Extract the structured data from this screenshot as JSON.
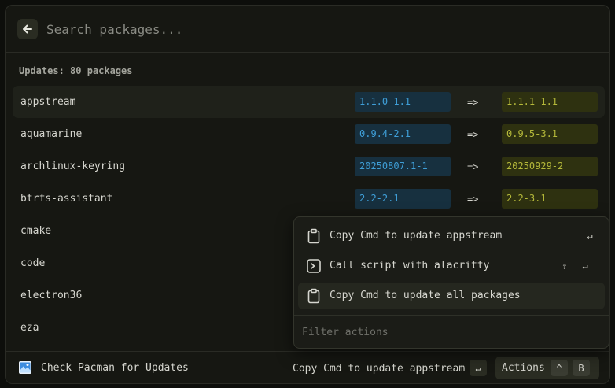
{
  "search": {
    "placeholder": "Search packages..."
  },
  "section": {
    "title": "Updates: 80 packages"
  },
  "packages": [
    {
      "name": "appstream",
      "old": "1.1.0-1.1",
      "arrow": "=>",
      "new": "1.1.1-1.1"
    },
    {
      "name": "aquamarine",
      "old": "0.9.4-2.1",
      "arrow": "=>",
      "new": "0.9.5-3.1"
    },
    {
      "name": "archlinux-keyring",
      "old": "20250807.1-1",
      "arrow": "=>",
      "new": "20250929-2"
    },
    {
      "name": "btrfs-assistant",
      "old": "2.2-2.1",
      "arrow": "=>",
      "new": "2.2-3.1"
    },
    {
      "name": "cmake"
    },
    {
      "name": "code"
    },
    {
      "name": "electron36"
    },
    {
      "name": "eza"
    }
  ],
  "action_menu": {
    "items": [
      {
        "label": "Copy Cmd to update appstream",
        "icon": "clipboard-icon",
        "shortcut": [
          "↵"
        ]
      },
      {
        "label": "Call script with alacritty",
        "icon": "terminal-icon",
        "shortcut": [
          "⇧",
          "↵"
        ]
      },
      {
        "label": "Copy Cmd to update all packages",
        "icon": "clipboard-icon",
        "shortcut": []
      }
    ],
    "filter_placeholder": "Filter actions"
  },
  "footer": {
    "title": "Check Pacman for Updates",
    "icon": "app-icon",
    "primary_action": "Copy Cmd to update appstream",
    "primary_key": "↵",
    "actions_label": "Actions",
    "actions_keys": [
      "^",
      "B"
    ]
  },
  "colors": {
    "background": "#161712",
    "old_version_bg": "#17303f",
    "old_version_text": "#3f9fd8",
    "new_version_bg": "#2e3110",
    "new_version_text": "#b5b93a"
  }
}
